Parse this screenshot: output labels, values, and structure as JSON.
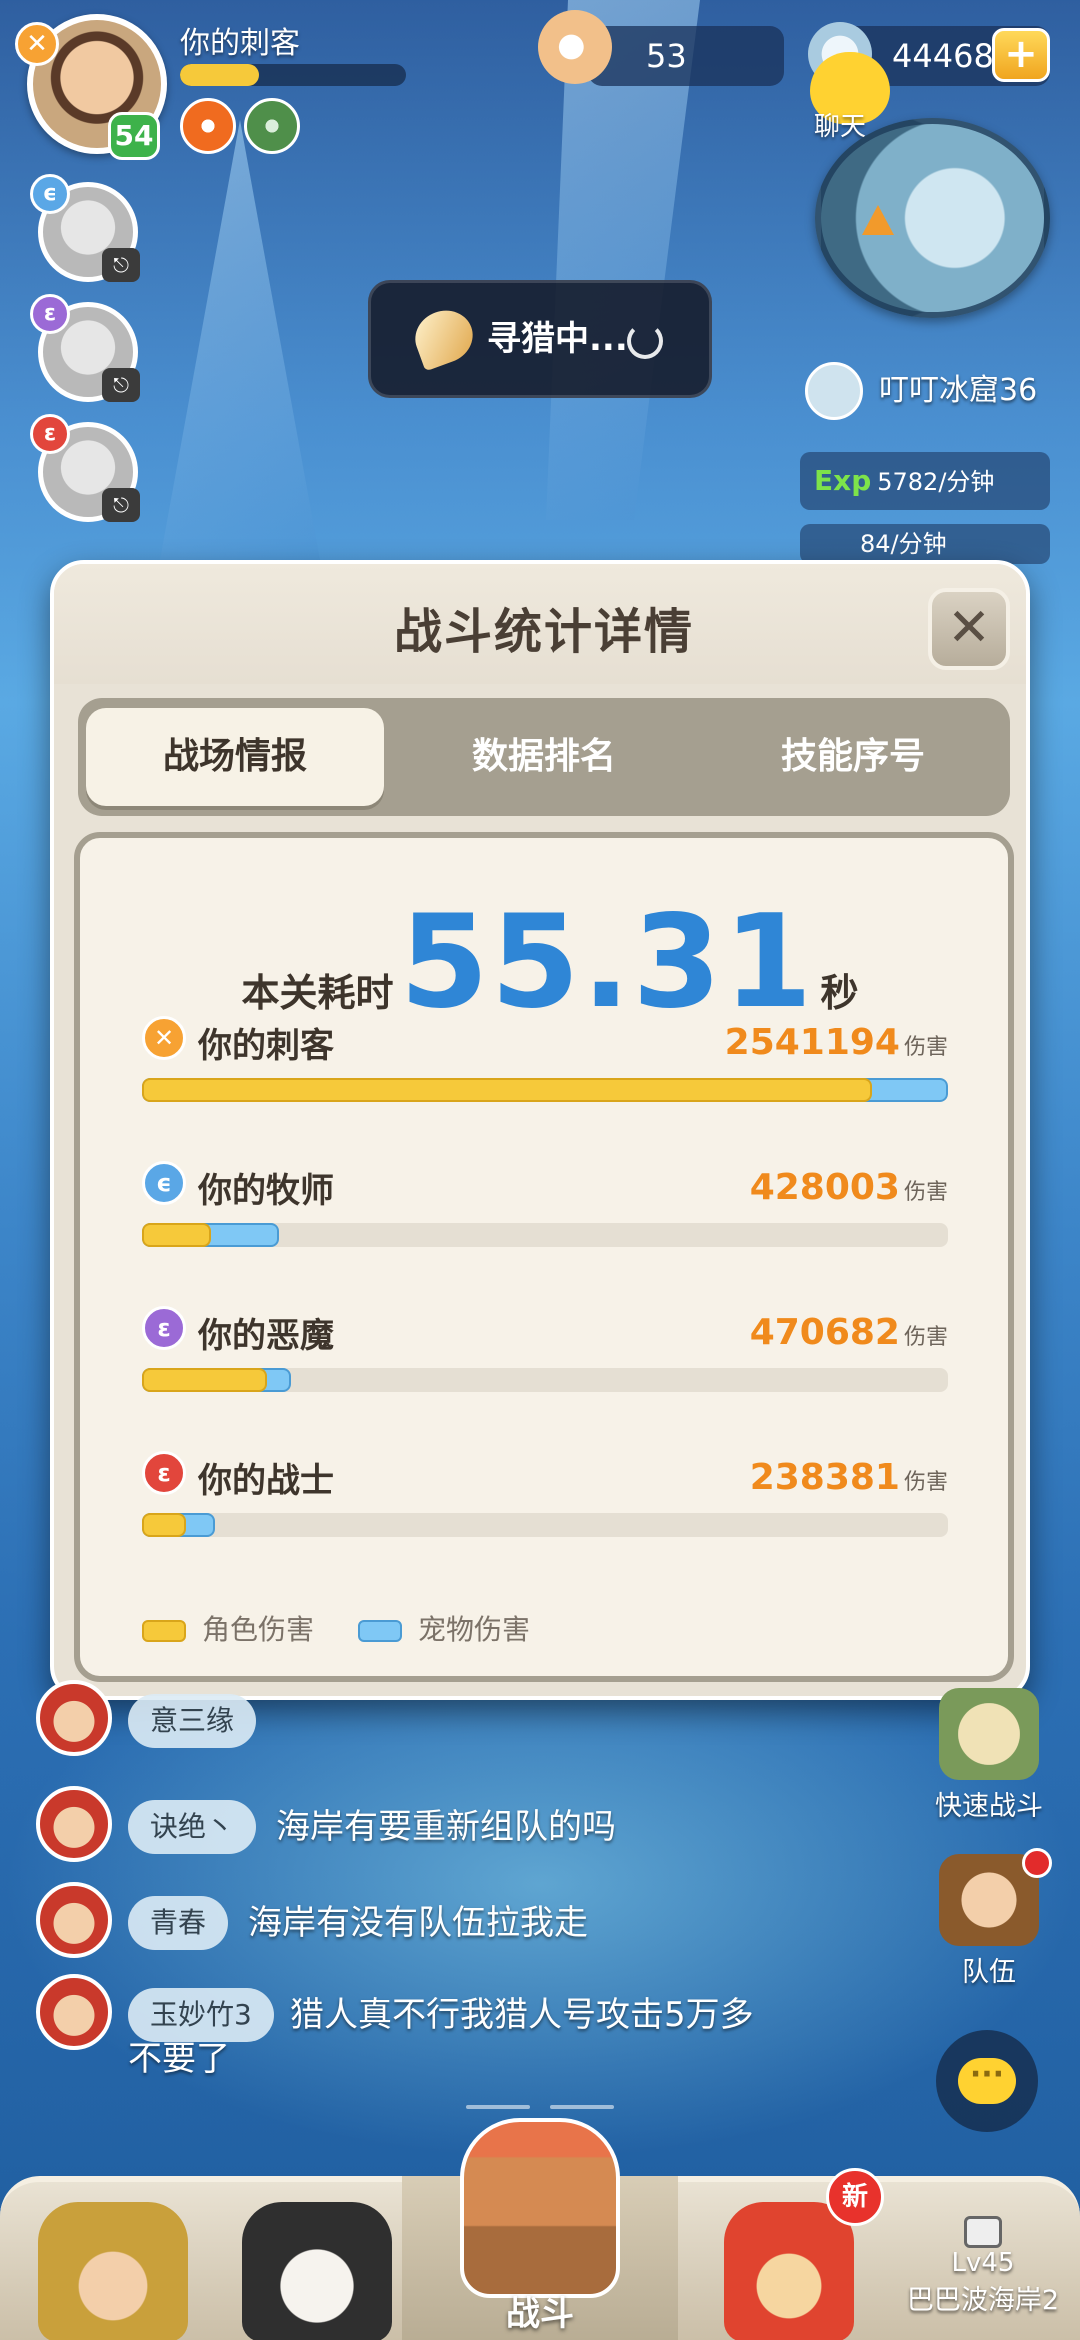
{
  "player": {
    "name": "你的刺客",
    "level": "54",
    "class_icon": "dagger-icon",
    "exp_progress": 0.35
  },
  "party": [
    {
      "class_icon": "priest-swirl-icon",
      "class_color": "#5aa7e6"
    },
    {
      "class_icon": "demon-swirl-icon",
      "class_color": "#9b6ad6"
    },
    {
      "class_icon": "warrior-flame-icon",
      "class_color": "#e2463c"
    }
  ],
  "currency": {
    "pearls": "53",
    "gems": "44468"
  },
  "top_chat_label": "聊天",
  "search_status": "寻猎中...",
  "zone": {
    "name": "叮叮冰窟36",
    "exp_rate_tag": "Exp",
    "exp_rate": "5782/分钟",
    "gold_rate": "84/分钟"
  },
  "modal": {
    "title": "战斗统计详情",
    "tabs": [
      "战场情报",
      "数据排名",
      "技能序号"
    ],
    "active_tab": 0,
    "time_label": "本关耗时",
    "time_value": "55.31",
    "time_unit": "秒",
    "damage_unit": "伤害",
    "legend": {
      "char": "角色伤害",
      "pet": "宠物伤害"
    },
    "colors": {
      "char": "#f6c93a",
      "pet": "#7fc8f5",
      "time": "#2f86d6",
      "damage": "#f08a1c"
    }
  },
  "chart_data": {
    "type": "bar",
    "categories": [
      "你的刺客",
      "你的牧师",
      "你的恶魔",
      "你的战士"
    ],
    "totals": [
      "2541194",
      "428003",
      "470682",
      "238381"
    ],
    "series": [
      {
        "name": "角色伤害",
        "values": [
          0.906,
          0.085,
          0.155,
          0.054
        ]
      },
      {
        "name": "宠物伤害",
        "values": [
          0.094,
          0.085,
          0.03,
          0.037
        ]
      }
    ],
    "class_icons": [
      "dagger-icon",
      "priest-swirl-icon",
      "demon-swirl-icon",
      "warrior-flame-icon"
    ],
    "class_colors": [
      "#f7a233",
      "#5aa7e6",
      "#9b6ad6",
      "#e2463c"
    ]
  },
  "chat": [
    {
      "name": "意三缘",
      "message": ""
    },
    {
      "name": "诀绝丶",
      "message": "海岸有要重新组队的吗"
    },
    {
      "name": "青春",
      "message": "海岸有没有队伍拉我走"
    },
    {
      "name": "玉妙竹3",
      "message": "猎人真不行我猎人号攻击5万多",
      "message_line2": "不要了"
    }
  ],
  "side_buttons": {
    "quick_battle": "快速战斗",
    "team": "队伍"
  },
  "bottom_nav": {
    "battle": "战斗",
    "new_badge": "新",
    "locked_level": "Lv45",
    "locked_zone": "巴巴波海岸2"
  }
}
